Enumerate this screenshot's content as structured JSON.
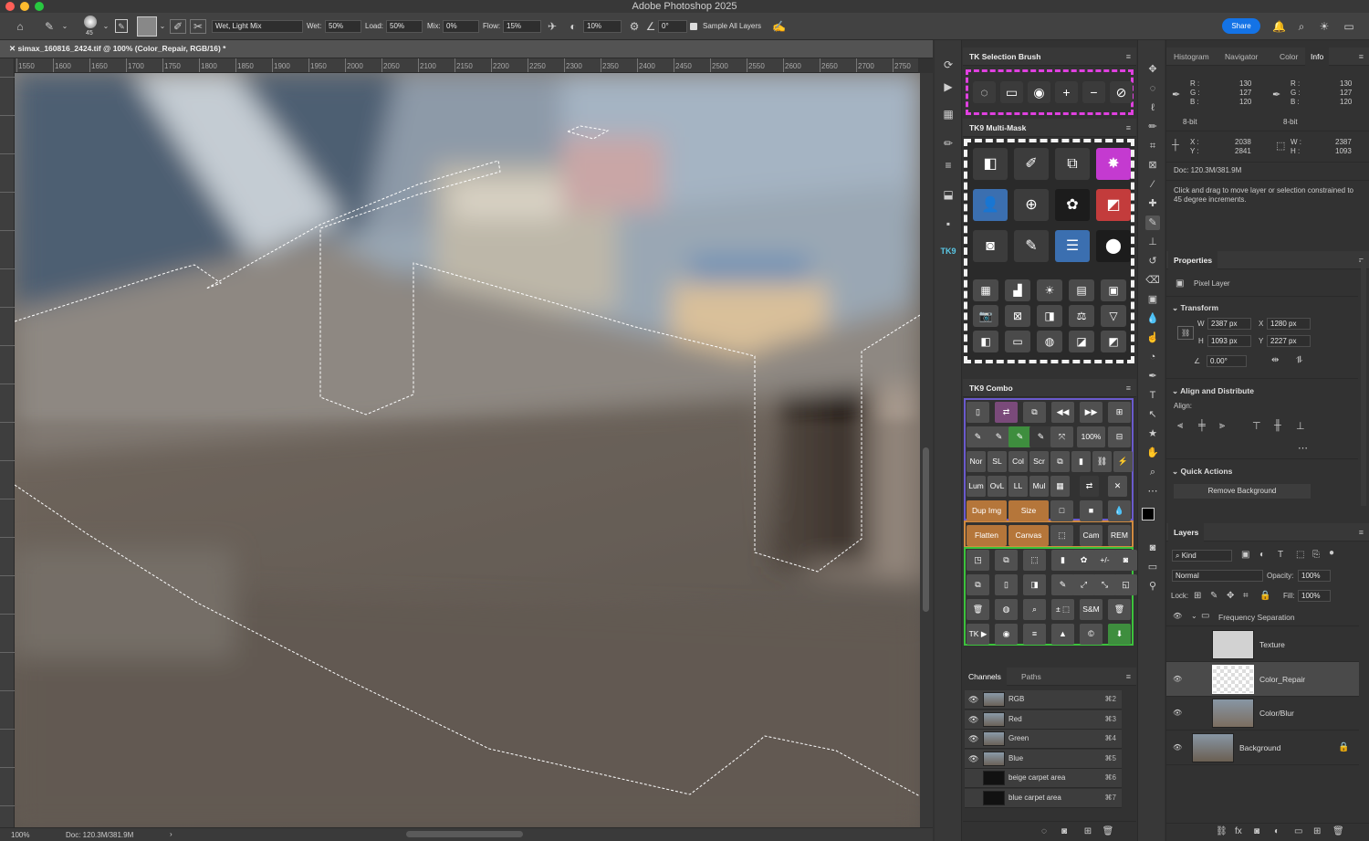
{
  "app": {
    "title": "Adobe Photoshop 2025"
  },
  "options": {
    "brush_size": "45",
    "mix_preset": "Wet, Light Mix",
    "wet_label": "Wet:",
    "wet_value": "50%",
    "load_label": "Load:",
    "load_value": "50%",
    "mix_label": "Mix:",
    "mix_value": "0%",
    "flow_label": "Flow:",
    "flow_value": "15%",
    "smoothing_value": "10%",
    "angle_value": "0°",
    "sample_all_layers": "Sample All Layers",
    "share_label": "Share"
  },
  "document": {
    "tab_title": "simax_160816_2424.tif @ 100% (Color_Repair, RGB/16) *",
    "ruler_ticks": [
      "1550",
      "1600",
      "1650",
      "1700",
      "1750",
      "1800",
      "1850",
      "1900",
      "1950",
      "2000",
      "2050",
      "2100",
      "2150",
      "2200",
      "2250",
      "2300",
      "2350",
      "2400",
      "2450",
      "2500",
      "2550",
      "2600",
      "2650",
      "2700",
      "2750"
    ],
    "zoom": "100%",
    "doc_status": "Doc: 120.3M/381.9M"
  },
  "tk_selection": {
    "title": "TK Selection Brush",
    "buttons": [
      "◌",
      "▭",
      "◉",
      "+",
      "−",
      "⊘"
    ]
  },
  "tk_multimask": {
    "title": "TK9 Multi-Mask"
  },
  "tk_combo": {
    "title": "TK9 Combo",
    "labels": {
      "zoom": "100%",
      "nor": "Nor",
      "sl": "SL",
      "col": "Col",
      "scr": "Scr",
      "lum": "Lum",
      "ovl": "OvL",
      "ll": "LL",
      "mul": "Mul",
      "dup": "Dup Img",
      "size": "Size",
      "flatten": "Flatten",
      "canvas": "Canvas",
      "cam": "Cam Raw",
      "rem": "REM CAF",
      "sm": "S&M",
      "tk": "TK ▶",
      "pm": "+/-",
      "pm2": "± ⬚"
    }
  },
  "channels": {
    "tabs": [
      "Channels",
      "Paths"
    ],
    "rows": [
      {
        "name": "RGB",
        "key": "⌘2",
        "eye": "👁"
      },
      {
        "name": "Red",
        "key": "⌘3",
        "eye": "👁"
      },
      {
        "name": "Green",
        "key": "⌘4",
        "eye": "👁"
      },
      {
        "name": "Blue",
        "key": "⌘5",
        "eye": "👁"
      },
      {
        "name": "beige carpet area",
        "key": "⌘6",
        "eye": ""
      },
      {
        "name": "blue carpet area",
        "key": "⌘7",
        "eye": ""
      }
    ]
  },
  "info": {
    "tabs": [
      "Histogram",
      "Navigator",
      "Color",
      "Info"
    ],
    "rgb1": {
      "r_label": "R :",
      "g_label": "G :",
      "b_label": "B :",
      "r": "130",
      "g": "127",
      "b": "120"
    },
    "rgb2": {
      "r_label": "R :",
      "g_label": "G :",
      "b_label": "B :",
      "r": "130",
      "g": "127",
      "b": "120"
    },
    "bit1": "8-bit",
    "bit2": "8-bit",
    "x_label": "X :",
    "y_label": "Y :",
    "x": "2038",
    "y": "2841",
    "w_label": "W :",
    "h_label": "H :",
    "w": "2387",
    "h": "1093",
    "doc": "Doc: 120.3M/381.9M",
    "hint": "Click and drag to move layer or selection constrained to 45 degree increments."
  },
  "properties": {
    "title": "Properties",
    "kind": "Pixel Layer",
    "transform": "Transform",
    "w_label": "W",
    "w": "2387 px",
    "x_label": "X",
    "x": "1280 px",
    "h_label": "H",
    "h": "1093 px",
    "y_label": "Y",
    "y": "2227 px",
    "angle": "0.00°",
    "align_title": "Align and Distribute",
    "align_label": "Align:",
    "quick_actions": "Quick Actions",
    "remove_bg": "Remove Background"
  },
  "layers": {
    "title": "Layers",
    "kind": "Kind",
    "blend": "Normal",
    "opacity_label": "Opacity:",
    "opacity": "100%",
    "lock_label": "Lock:",
    "fill_label": "Fill:",
    "fill": "100%",
    "group": "Frequency Separation",
    "rows": [
      {
        "name": "Texture",
        "visible": ""
      },
      {
        "name": "Color_Repair",
        "visible": "👁"
      },
      {
        "name": "Color/Blur",
        "visible": "👁"
      },
      {
        "name": "Background",
        "visible": "👁"
      }
    ]
  },
  "colors": {
    "accent_blue": "#1473e6",
    "magenta": "#e040e0",
    "selection": "#ffffff"
  }
}
